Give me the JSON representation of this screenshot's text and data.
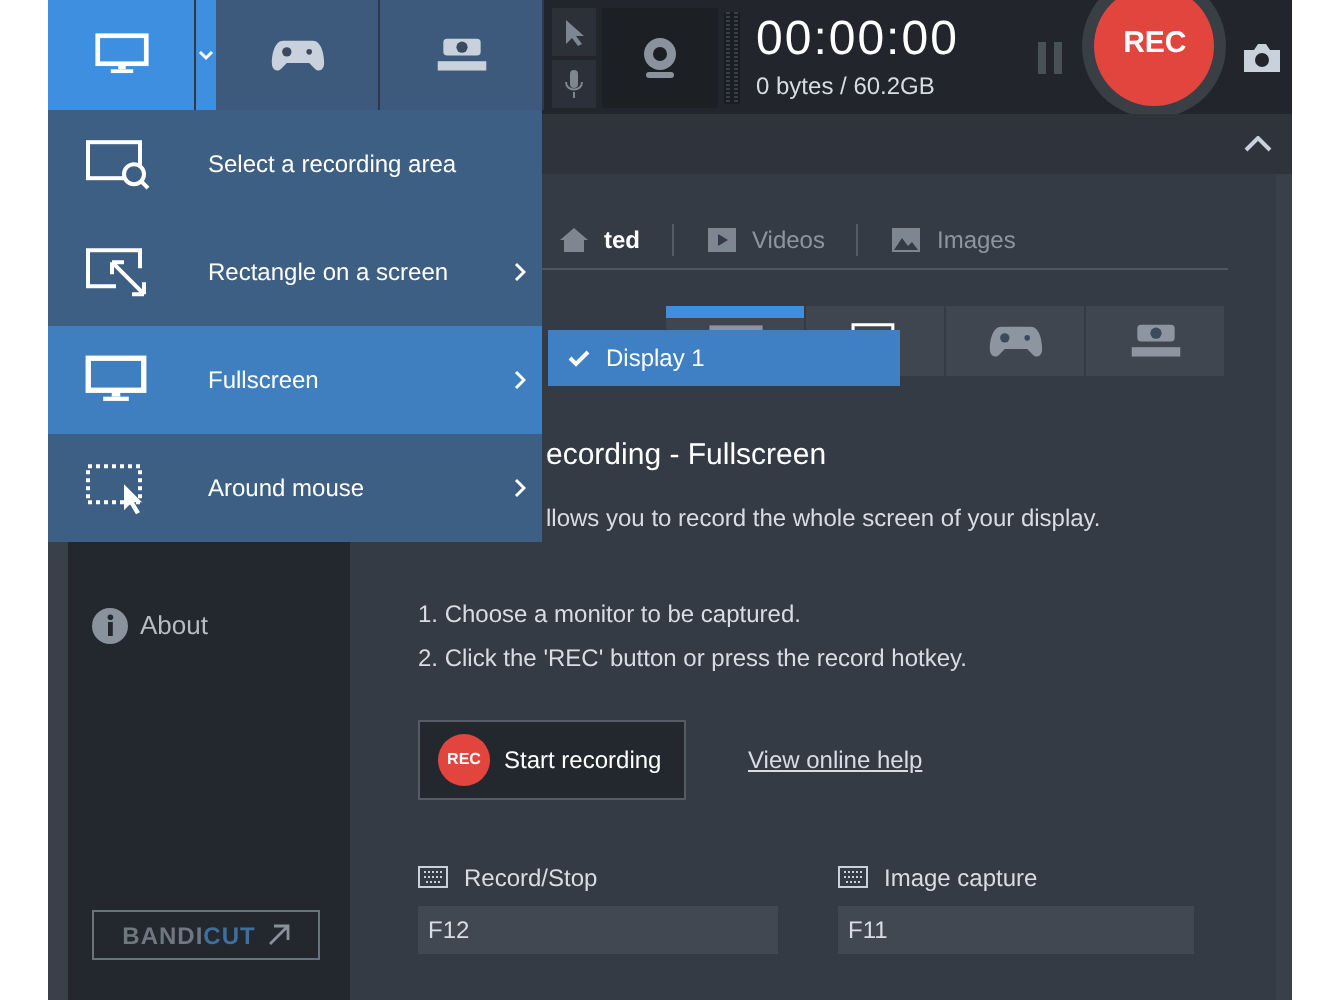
{
  "top_bar": {
    "mode_buttons": [
      {
        "kind": "screen",
        "selected": true
      },
      {
        "kind": "game",
        "selected": false
      },
      {
        "kind": "hdmi",
        "selected": false
      }
    ],
    "timer": "00:00:00",
    "storage": "0 bytes / 60.2GB",
    "rec_button": "REC"
  },
  "mode_menu": {
    "items": [
      {
        "label": "Select a recording area",
        "kind": "area",
        "submenu": false,
        "selected": false
      },
      {
        "label": "Rectangle on a screen",
        "kind": "rectangle",
        "submenu": true,
        "selected": false
      },
      {
        "label": "Fullscreen",
        "kind": "screen",
        "submenu": true,
        "selected": true
      },
      {
        "label": "Around mouse",
        "kind": "mouse",
        "submenu": true,
        "selected": false
      }
    ]
  },
  "display_popup": {
    "label": "Display 1",
    "checked": true
  },
  "sidebar": {
    "items": [
      {
        "label": "About"
      }
    ],
    "bandicut": {
      "brand": "BANDI",
      "accent": "CUT"
    }
  },
  "content": {
    "tabs": [
      {
        "label": "ted",
        "kind": "start",
        "selected": true
      },
      {
        "label": "Videos",
        "kind": "video",
        "selected": false
      },
      {
        "label": "Images",
        "kind": "image",
        "selected": false
      }
    ],
    "mode_tabs": [
      {
        "kind": "screen",
        "selected": true
      },
      {
        "kind": "area",
        "selected": false
      },
      {
        "kind": "game",
        "selected": false
      },
      {
        "kind": "hdmi",
        "selected": false
      }
    ],
    "heading": "ecording - Fullscreen",
    "description": "llows you to record the whole screen of your display.",
    "steps": [
      "1. Choose a monitor to be captured.",
      "2. Click the 'REC' button or press the record hotkey."
    ],
    "start_button": {
      "badge": "REC",
      "label": "Start recording"
    },
    "help_link": "View online help",
    "hotkeys": [
      {
        "label": "Record/Stop",
        "value": "F12"
      },
      {
        "label": "Image capture",
        "value": "F11"
      }
    ]
  }
}
